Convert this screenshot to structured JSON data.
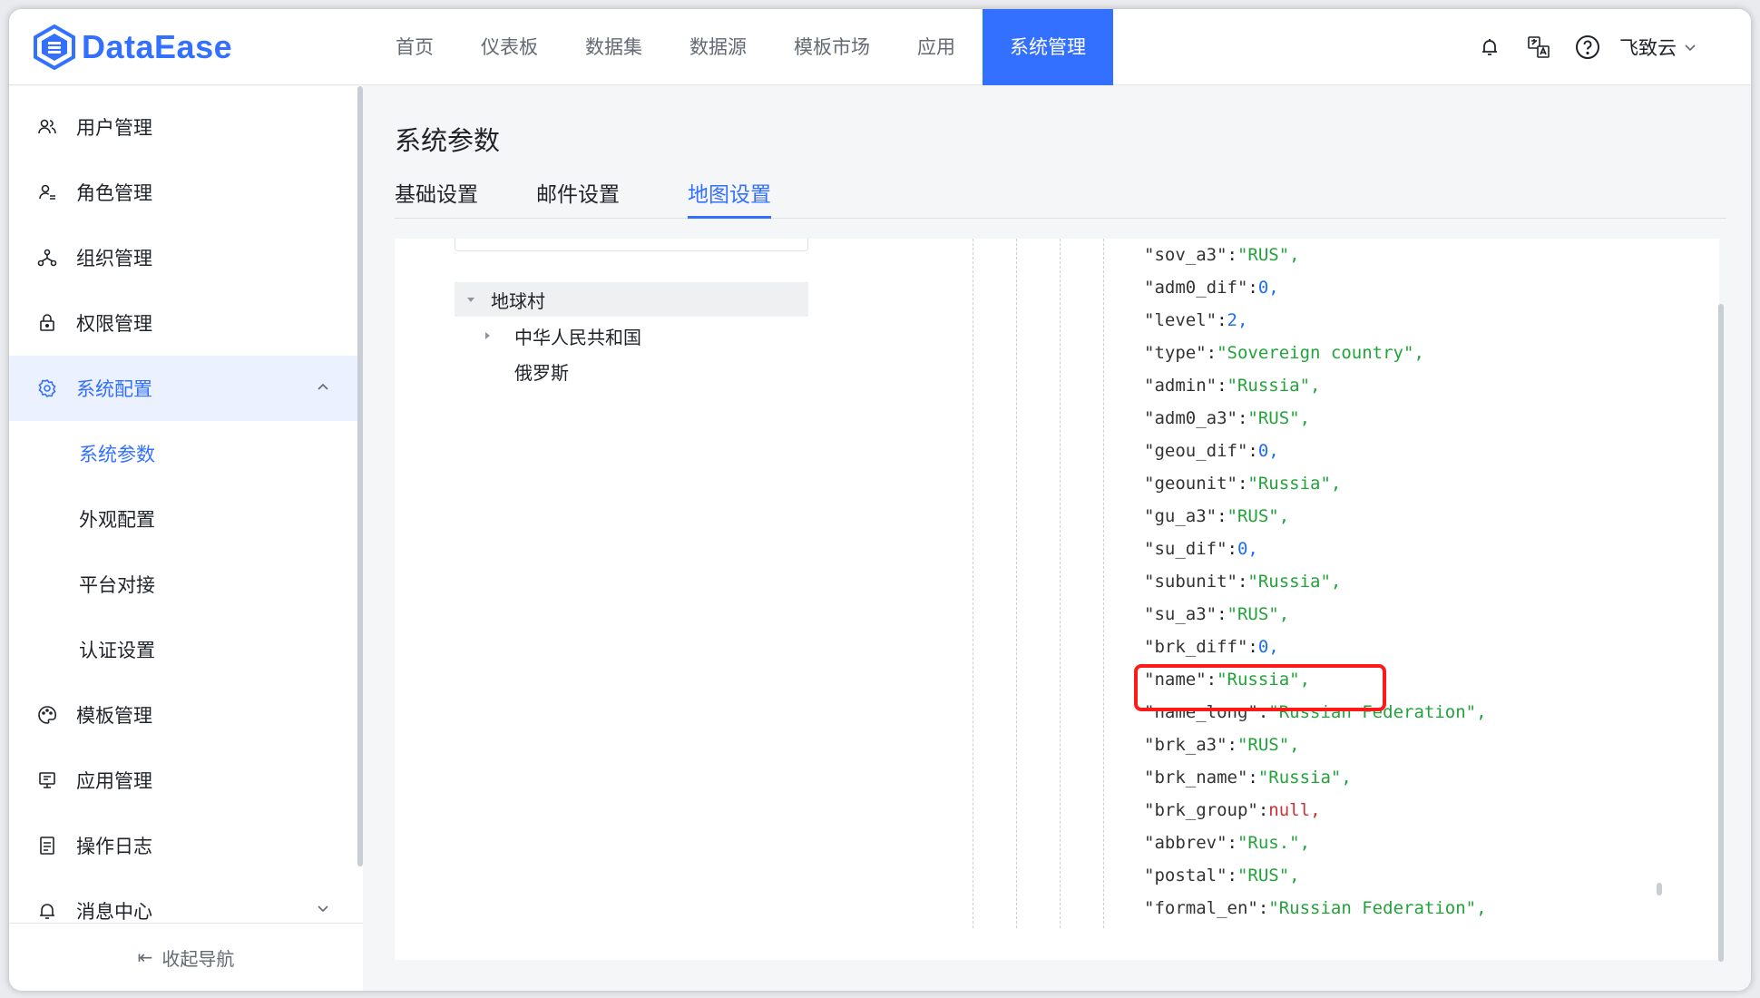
{
  "header": {
    "logo_text": "DataEase",
    "nav": [
      "首页",
      "仪表板",
      "数据集",
      "数据源",
      "模板市场",
      "应用",
      "系统管理"
    ],
    "active_nav": "系统管理",
    "user_name": "飞致云"
  },
  "sidebar": {
    "items": [
      {
        "label": "用户管理",
        "icon": "users-icon"
      },
      {
        "label": "角色管理",
        "icon": "role-icon"
      },
      {
        "label": "组织管理",
        "icon": "org-icon"
      },
      {
        "label": "权限管理",
        "icon": "lock-icon"
      },
      {
        "label": "系统配置",
        "icon": "gear-icon"
      },
      {
        "label": "模板管理",
        "icon": "palette-icon"
      },
      {
        "label": "应用管理",
        "icon": "app-icon"
      },
      {
        "label": "操作日志",
        "icon": "log-icon"
      },
      {
        "label": "消息中心",
        "icon": "bell-icon"
      }
    ],
    "sub_items": [
      "系统参数",
      "外观配置",
      "平台对接",
      "认证设置"
    ],
    "collapse_label": "收起导航"
  },
  "page": {
    "title": "系统参数",
    "tabs": [
      "基础设置",
      "邮件设置",
      "地图设置"
    ],
    "active_tab": "地图设置"
  },
  "tree": {
    "root": "地球村",
    "children": [
      "中华人民共和国",
      "俄罗斯"
    ]
  },
  "code_lines": [
    {
      "key": "\"sov_a3\"",
      "value": "\"RUS\"",
      "type": "s"
    },
    {
      "key": "\"adm0_dif\"",
      "value": "0",
      "type": "n"
    },
    {
      "key": "\"level\"",
      "value": "2",
      "type": "n"
    },
    {
      "key": "\"type\"",
      "value": "\"Sovereign country\"",
      "type": "s"
    },
    {
      "key": "\"admin\"",
      "value": "\"Russia\"",
      "type": "s"
    },
    {
      "key": "\"adm0_a3\"",
      "value": "\"RUS\"",
      "type": "s"
    },
    {
      "key": "\"geou_dif\"",
      "value": "0",
      "type": "n"
    },
    {
      "key": "\"geounit\"",
      "value": "\"Russia\"",
      "type": "s"
    },
    {
      "key": "\"gu_a3\"",
      "value": "\"RUS\"",
      "type": "s"
    },
    {
      "key": "\"su_dif\"",
      "value": "0",
      "type": "n"
    },
    {
      "key": "\"subunit\"",
      "value": "\"Russia\"",
      "type": "s"
    },
    {
      "key": "\"su_a3\"",
      "value": "\"RUS\"",
      "type": "s"
    },
    {
      "key": "\"brk_diff\"",
      "value": "0",
      "type": "n"
    },
    {
      "key": "\"name\"",
      "value": "\"Russia\"",
      "type": "s"
    },
    {
      "key": "\"name_long\"",
      "value": "\"Russian Federation\"",
      "type": "s"
    },
    {
      "key": "\"brk_a3\"",
      "value": "\"RUS\"",
      "type": "s"
    },
    {
      "key": "\"brk_name\"",
      "value": "\"Russia\"",
      "type": "s"
    },
    {
      "key": "\"brk_group\"",
      "value": "null",
      "type": "nl"
    },
    {
      "key": "\"abbrev\"",
      "value": "\"Rus.\"",
      "type": "s"
    },
    {
      "key": "\"postal\"",
      "value": "\"RUS\"",
      "type": "s"
    },
    {
      "key": "\"formal_en\"",
      "value": "\"Russian Federation\"",
      "type": "s"
    }
  ],
  "colors": {
    "accent": "#3370ff",
    "highlight": "#ff1a1a",
    "string": "#22a33a",
    "number": "#1d6ff2",
    "null": "#d03030"
  }
}
